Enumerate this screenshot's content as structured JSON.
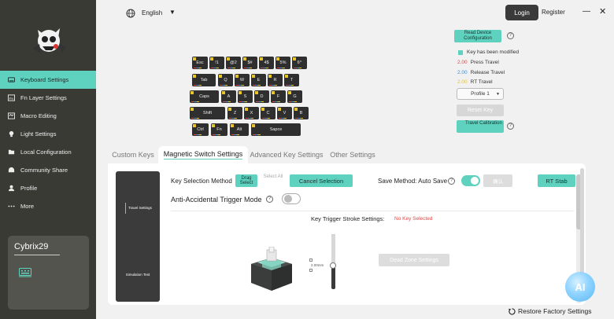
{
  "colors": {
    "accent": "#5fd1bf",
    "sidebar": "#3a3a34",
    "press": "#e04848",
    "release": "#3a8fe0",
    "rt": "#e8c52a"
  },
  "sidebar": {
    "items": [
      {
        "label": "Keyboard Settings",
        "icon": "keyboard-icon",
        "active": true
      },
      {
        "label": "Fn Layer Settings",
        "icon": "fn-layer-icon",
        "active": false
      },
      {
        "label": "Macro Editing",
        "icon": "macro-icon",
        "active": false
      },
      {
        "label": "Light Settings",
        "icon": "light-icon",
        "active": false
      },
      {
        "label": "Local Configuration",
        "icon": "local-config-icon",
        "active": false
      },
      {
        "label": "Community Share",
        "icon": "share-icon",
        "active": false
      },
      {
        "label": "Profile",
        "icon": "profile-icon",
        "active": false
      },
      {
        "label": "More",
        "icon": "more-icon",
        "active": false
      }
    ],
    "device_name": "Cybrix29"
  },
  "topbar": {
    "language": "English",
    "login": "Login",
    "register": "Register",
    "minimize": "—",
    "close": "✕"
  },
  "keyboard": {
    "keys": [
      [
        "Esc",
        "!1",
        "@2",
        "$#",
        "4$",
        "5%",
        "6^"
      ],
      [
        "Tab",
        "Q",
        "W",
        "E",
        "R",
        "T"
      ],
      [
        "Caps",
        "A",
        "S",
        "D",
        "F",
        "G"
      ],
      [
        "Shift",
        "Z",
        "X",
        "C",
        "V",
        "B"
      ],
      [
        "Ctrl",
        "Fn",
        "Alt",
        "Sapce"
      ]
    ]
  },
  "right_panel": {
    "read_config": "Read Device Configuration",
    "modified_legend": "Key has been modified",
    "travel_legend": [
      {
        "value": "2.00",
        "label": "Press Travel",
        "color": "#e04848"
      },
      {
        "value": "2.00",
        "label": "Release Travel",
        "color": "#3a8fe0"
      },
      {
        "value": "2.00",
        "label": "RT Travel",
        "color": "#e8c52a"
      }
    ],
    "profile": "Profile 1",
    "reset_key": "Reset Key",
    "travel_calibration": "Travel Calibration"
  },
  "tabs": [
    "Custom Keys",
    "Magnetic Switch Settings",
    "Advanced Key Settings",
    "Other Settings"
  ],
  "active_tab": 1,
  "panel": {
    "preview_label_top": "Travel Settings",
    "preview_label_bottom": "Simulation Test",
    "key_selection_label": "Key Selection Method",
    "drag_select": "Drag Select",
    "select_all": "Select All",
    "cancel_selection": "Cancel Selection",
    "save_method": "Save Method: Auto Save",
    "auto_save_on": true,
    "confirm": "确认",
    "rt_stab": "RT Stab",
    "anti_accidental": "Anti-Accidental Trigger Mode",
    "anti_accidental_on": false,
    "stroke_label": "Key Trigger Stroke Settings:",
    "no_key": "No Key Selected",
    "slider_value": "2.00mm",
    "dead_zone": "Dead Zone Settings"
  },
  "restore": "Restore Factory Settings",
  "ai_badge": "AI"
}
